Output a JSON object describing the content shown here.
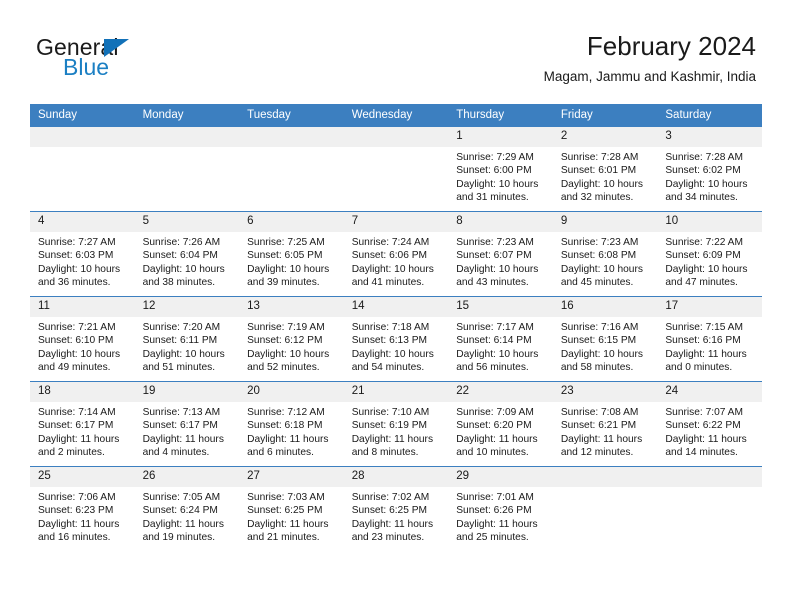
{
  "brand": {
    "name_top": "General",
    "name_bottom": "Blue",
    "triangle_color": "#1271b8",
    "blue_color": "#1b7fc3"
  },
  "header": {
    "title": "February 2024",
    "subtitle": "Magam, Jammu and Kashmir, India"
  },
  "theme": {
    "header_row_bg": "#3c7fc0",
    "daynum_bg": "#f0f0f0",
    "text_color": "#1a1a1a"
  },
  "weekday_headers": [
    "Sunday",
    "Monday",
    "Tuesday",
    "Wednesday",
    "Thursday",
    "Friday",
    "Saturday"
  ],
  "weeks": [
    [
      {
        "day": "",
        "sunrise": "",
        "sunset": "",
        "daylight1": "",
        "daylight2": ""
      },
      {
        "day": "",
        "sunrise": "",
        "sunset": "",
        "daylight1": "",
        "daylight2": ""
      },
      {
        "day": "",
        "sunrise": "",
        "sunset": "",
        "daylight1": "",
        "daylight2": ""
      },
      {
        "day": "",
        "sunrise": "",
        "sunset": "",
        "daylight1": "",
        "daylight2": ""
      },
      {
        "day": "1",
        "sunrise": "Sunrise: 7:29 AM",
        "sunset": "Sunset: 6:00 PM",
        "daylight1": "Daylight: 10 hours",
        "daylight2": "and 31 minutes."
      },
      {
        "day": "2",
        "sunrise": "Sunrise: 7:28 AM",
        "sunset": "Sunset: 6:01 PM",
        "daylight1": "Daylight: 10 hours",
        "daylight2": "and 32 minutes."
      },
      {
        "day": "3",
        "sunrise": "Sunrise: 7:28 AM",
        "sunset": "Sunset: 6:02 PM",
        "daylight1": "Daylight: 10 hours",
        "daylight2": "and 34 minutes."
      }
    ],
    [
      {
        "day": "4",
        "sunrise": "Sunrise: 7:27 AM",
        "sunset": "Sunset: 6:03 PM",
        "daylight1": "Daylight: 10 hours",
        "daylight2": "and 36 minutes."
      },
      {
        "day": "5",
        "sunrise": "Sunrise: 7:26 AM",
        "sunset": "Sunset: 6:04 PM",
        "daylight1": "Daylight: 10 hours",
        "daylight2": "and 38 minutes."
      },
      {
        "day": "6",
        "sunrise": "Sunrise: 7:25 AM",
        "sunset": "Sunset: 6:05 PM",
        "daylight1": "Daylight: 10 hours",
        "daylight2": "and 39 minutes."
      },
      {
        "day": "7",
        "sunrise": "Sunrise: 7:24 AM",
        "sunset": "Sunset: 6:06 PM",
        "daylight1": "Daylight: 10 hours",
        "daylight2": "and 41 minutes."
      },
      {
        "day": "8",
        "sunrise": "Sunrise: 7:23 AM",
        "sunset": "Sunset: 6:07 PM",
        "daylight1": "Daylight: 10 hours",
        "daylight2": "and 43 minutes."
      },
      {
        "day": "9",
        "sunrise": "Sunrise: 7:23 AM",
        "sunset": "Sunset: 6:08 PM",
        "daylight1": "Daylight: 10 hours",
        "daylight2": "and 45 minutes."
      },
      {
        "day": "10",
        "sunrise": "Sunrise: 7:22 AM",
        "sunset": "Sunset: 6:09 PM",
        "daylight1": "Daylight: 10 hours",
        "daylight2": "and 47 minutes."
      }
    ],
    [
      {
        "day": "11",
        "sunrise": "Sunrise: 7:21 AM",
        "sunset": "Sunset: 6:10 PM",
        "daylight1": "Daylight: 10 hours",
        "daylight2": "and 49 minutes."
      },
      {
        "day": "12",
        "sunrise": "Sunrise: 7:20 AM",
        "sunset": "Sunset: 6:11 PM",
        "daylight1": "Daylight: 10 hours",
        "daylight2": "and 51 minutes."
      },
      {
        "day": "13",
        "sunrise": "Sunrise: 7:19 AM",
        "sunset": "Sunset: 6:12 PM",
        "daylight1": "Daylight: 10 hours",
        "daylight2": "and 52 minutes."
      },
      {
        "day": "14",
        "sunrise": "Sunrise: 7:18 AM",
        "sunset": "Sunset: 6:13 PM",
        "daylight1": "Daylight: 10 hours",
        "daylight2": "and 54 minutes."
      },
      {
        "day": "15",
        "sunrise": "Sunrise: 7:17 AM",
        "sunset": "Sunset: 6:14 PM",
        "daylight1": "Daylight: 10 hours",
        "daylight2": "and 56 minutes."
      },
      {
        "day": "16",
        "sunrise": "Sunrise: 7:16 AM",
        "sunset": "Sunset: 6:15 PM",
        "daylight1": "Daylight: 10 hours",
        "daylight2": "and 58 minutes."
      },
      {
        "day": "17",
        "sunrise": "Sunrise: 7:15 AM",
        "sunset": "Sunset: 6:16 PM",
        "daylight1": "Daylight: 11 hours",
        "daylight2": "and 0 minutes."
      }
    ],
    [
      {
        "day": "18",
        "sunrise": "Sunrise: 7:14 AM",
        "sunset": "Sunset: 6:17 PM",
        "daylight1": "Daylight: 11 hours",
        "daylight2": "and 2 minutes."
      },
      {
        "day": "19",
        "sunrise": "Sunrise: 7:13 AM",
        "sunset": "Sunset: 6:17 PM",
        "daylight1": "Daylight: 11 hours",
        "daylight2": "and 4 minutes."
      },
      {
        "day": "20",
        "sunrise": "Sunrise: 7:12 AM",
        "sunset": "Sunset: 6:18 PM",
        "daylight1": "Daylight: 11 hours",
        "daylight2": "and 6 minutes."
      },
      {
        "day": "21",
        "sunrise": "Sunrise: 7:10 AM",
        "sunset": "Sunset: 6:19 PM",
        "daylight1": "Daylight: 11 hours",
        "daylight2": "and 8 minutes."
      },
      {
        "day": "22",
        "sunrise": "Sunrise: 7:09 AM",
        "sunset": "Sunset: 6:20 PM",
        "daylight1": "Daylight: 11 hours",
        "daylight2": "and 10 minutes."
      },
      {
        "day": "23",
        "sunrise": "Sunrise: 7:08 AM",
        "sunset": "Sunset: 6:21 PM",
        "daylight1": "Daylight: 11 hours",
        "daylight2": "and 12 minutes."
      },
      {
        "day": "24",
        "sunrise": "Sunrise: 7:07 AM",
        "sunset": "Sunset: 6:22 PM",
        "daylight1": "Daylight: 11 hours",
        "daylight2": "and 14 minutes."
      }
    ],
    [
      {
        "day": "25",
        "sunrise": "Sunrise: 7:06 AM",
        "sunset": "Sunset: 6:23 PM",
        "daylight1": "Daylight: 11 hours",
        "daylight2": "and 16 minutes."
      },
      {
        "day": "26",
        "sunrise": "Sunrise: 7:05 AM",
        "sunset": "Sunset: 6:24 PM",
        "daylight1": "Daylight: 11 hours",
        "daylight2": "and 19 minutes."
      },
      {
        "day": "27",
        "sunrise": "Sunrise: 7:03 AM",
        "sunset": "Sunset: 6:25 PM",
        "daylight1": "Daylight: 11 hours",
        "daylight2": "and 21 minutes."
      },
      {
        "day": "28",
        "sunrise": "Sunrise: 7:02 AM",
        "sunset": "Sunset: 6:25 PM",
        "daylight1": "Daylight: 11 hours",
        "daylight2": "and 23 minutes."
      },
      {
        "day": "29",
        "sunrise": "Sunrise: 7:01 AM",
        "sunset": "Sunset: 6:26 PM",
        "daylight1": "Daylight: 11 hours",
        "daylight2": "and 25 minutes."
      },
      {
        "day": "",
        "sunrise": "",
        "sunset": "",
        "daylight1": "",
        "daylight2": ""
      },
      {
        "day": "",
        "sunrise": "",
        "sunset": "",
        "daylight1": "",
        "daylight2": ""
      }
    ]
  ]
}
